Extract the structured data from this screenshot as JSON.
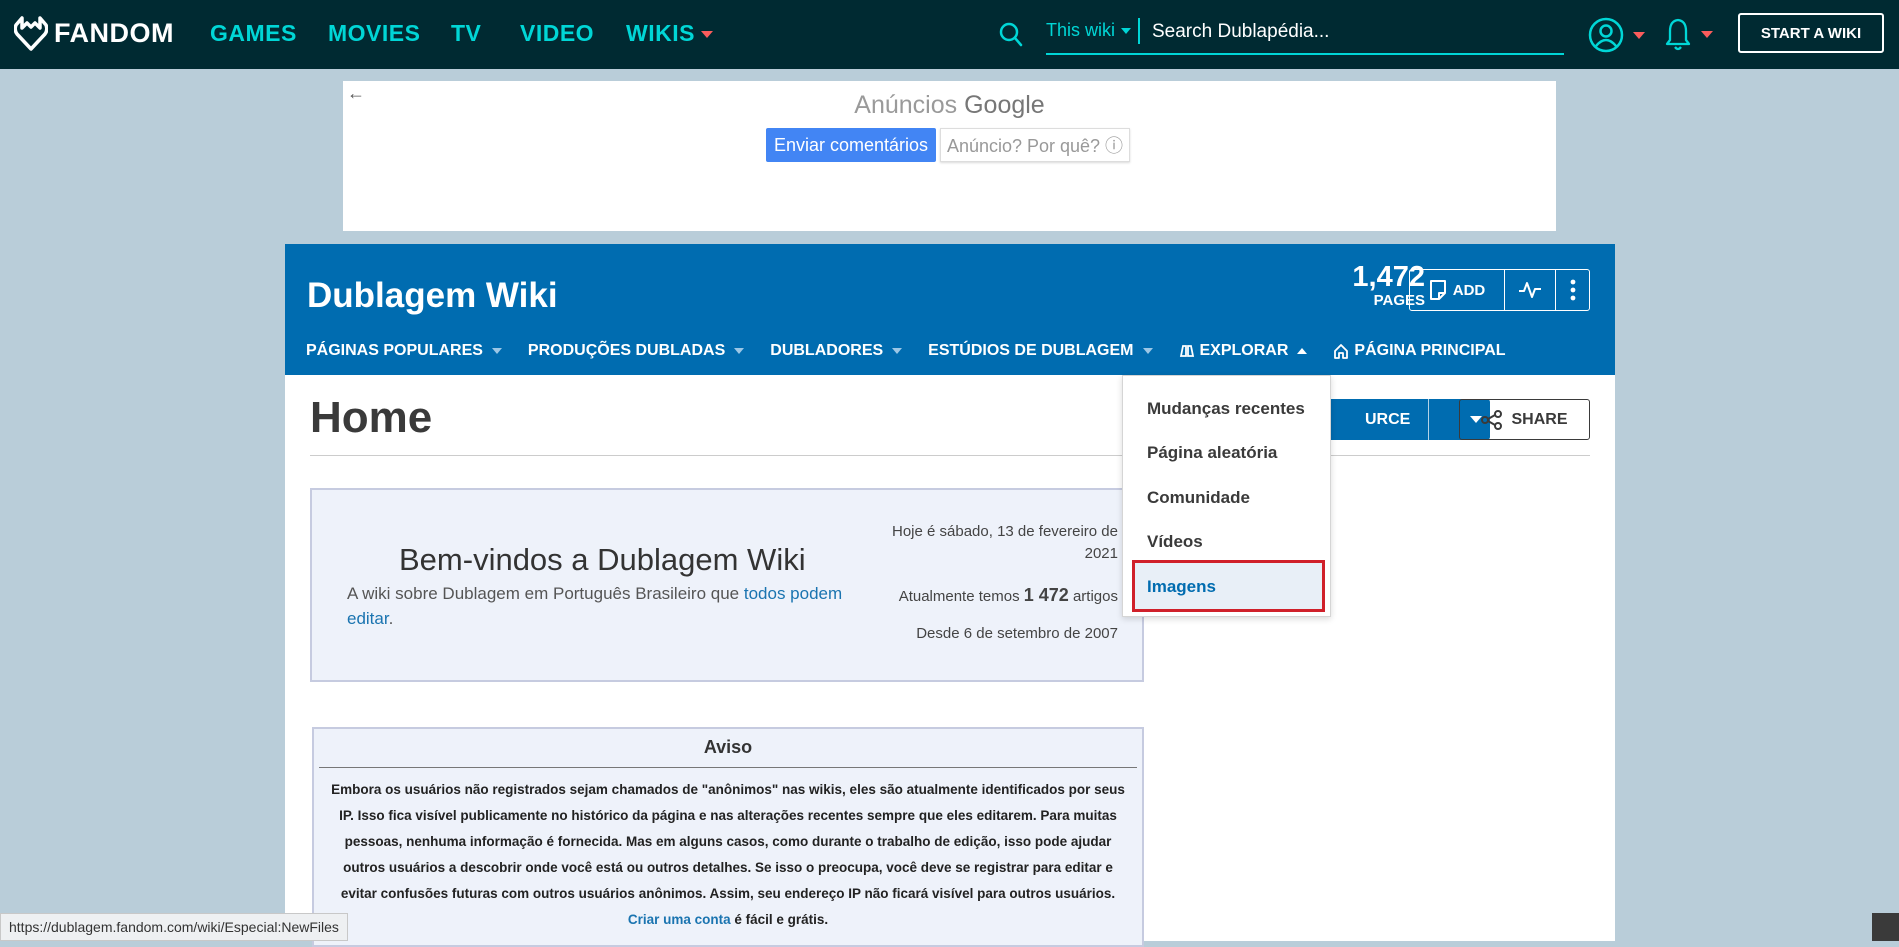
{
  "global_nav": {
    "logo": "FANDOM",
    "links": [
      "GAMES",
      "MOVIES",
      "TV",
      "VIDEO",
      "WIKIS"
    ],
    "search_scope": "This wiki",
    "search_placeholder": "Search Dublapédia...",
    "start_wiki": "START A WIKI"
  },
  "ad": {
    "back": "←",
    "title_prefix": "Anúncios",
    "title_brand": "Google",
    "feedback_button": "Enviar comentários",
    "why_button": "Anúncio? Por quê? ⓘ"
  },
  "wiki_header": {
    "title": "Dublagem Wiki",
    "pages_count": "1,472",
    "pages_label": "PAGES",
    "add_label": "ADD",
    "nav": [
      {
        "label": "PÁGINAS POPULARES"
      },
      {
        "label": "PRODUÇÕES DUBLADAS"
      },
      {
        "label": "DUBLADORES"
      },
      {
        "label": "ESTÚDIOS DE DUBLAGEM"
      },
      {
        "label": "EXPLORAR"
      },
      {
        "label": "PÁGINA PRINCIPAL"
      }
    ]
  },
  "explore_menu": {
    "items": [
      "Mudanças recentes",
      "Página aleatória",
      "Comunidade",
      "Vídeos",
      "Imagens"
    ],
    "highlighted": "Imagens",
    "highlight_color": "#d0202a"
  },
  "page": {
    "title": "Home",
    "source_button": "URCE",
    "share_button": "SHARE",
    "welcome": {
      "title": "Bem-vindos a Dublagem Wiki",
      "subtitle_prefix": "A wiki sobre Dublagem em Português Brasileiro que ",
      "subtitle_link": "todos podem editar",
      "subtitle_suffix": ".",
      "date": "Hoje é sábado, 13 de fevereiro de 2021",
      "count_prefix": "Atualmente temos ",
      "count_value": "1 472",
      "count_suffix": " artigos",
      "since": "Desde 6 de setembro de 2007"
    },
    "aviso": {
      "title": "Aviso",
      "body": "Embora os usuários não registrados sejam chamados de \"anônimos\" nas wikis, eles são atualmente identificados por seus IP. Isso fica visível publicamente no histórico da página e nas alterações recentes sempre que eles editarem. Para muitas pessoas, nenhuma informação é fornecida. Mas em alguns casos, como durante o trabalho de edição, isso pode ajudar outros usuários a descobrir onde você está ou outros detalhes. Se isso o preocupa, você deve se registrar para editar e evitar confusões futuras com outros usuários anônimos. Assim, seu endereço IP não ficará visível para outros usuários. ",
      "link": "Criar uma conta",
      "suffix": " é fácil e grátis."
    }
  },
  "status_url": "https://dublagem.fandom.com/wiki/Especial:NewFiles",
  "colors": {
    "nav_bg": "#002a32",
    "accent": "#00d6d6",
    "wiki_blue": "#006cb0",
    "page_bg": "#b9cdd9"
  }
}
